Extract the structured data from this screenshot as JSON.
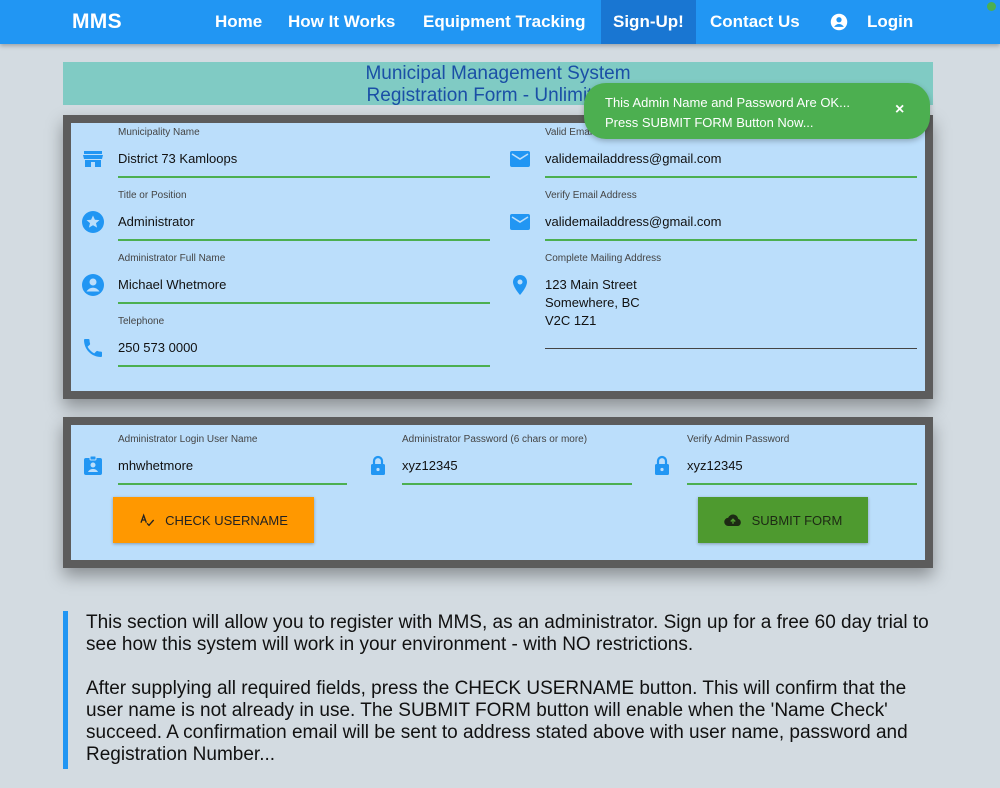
{
  "navbar": {
    "brand": "MMS",
    "items": [
      {
        "label": "Home"
      },
      {
        "label": "How It Works"
      },
      {
        "label": "Equipment Tracking"
      },
      {
        "label": "Sign-Up!"
      },
      {
        "label": "Contact Us"
      }
    ],
    "login_label": "Login"
  },
  "banner": {
    "line1": "Municipal Management System",
    "line2": "Registration Form - Unlimited 6"
  },
  "form": {
    "municipality": {
      "label": "Municipality Name",
      "value": "District 73 Kamloops"
    },
    "title": {
      "label": "Title or Position",
      "value": "Administrator"
    },
    "admin_name": {
      "label": "Administrator Full Name",
      "value": "Michael Whetmore"
    },
    "telephone": {
      "label": "Telephone",
      "value": "250 573 0000"
    },
    "email": {
      "label": "Valid Emai",
      "value": "validemailaddress@gmail.com"
    },
    "verify_email": {
      "label": "Verify Email Address",
      "value": "validemailaddress@gmail.com"
    },
    "address": {
      "label": "Complete Mailing Address",
      "lines": [
        "123 Main Street",
        "Somewhere, BC",
        "V2C 1Z1"
      ]
    }
  },
  "login_form": {
    "username": {
      "label": "Administrator Login User Name",
      "value": "mhwhetmore"
    },
    "password": {
      "label": "Administrator Password (6 chars or more)",
      "value": "xyz12345"
    },
    "verify_password": {
      "label": "Verify Admin Password",
      "value": "xyz12345"
    },
    "check_button": "CHECK USERNAME",
    "submit_button": "SUBMIT FORM"
  },
  "toast": {
    "line1": "This Admin Name and Password Are OK...",
    "line2": "Press SUBMIT FORM Button Now...",
    "close": "×"
  },
  "info": {
    "para1": "This section will allow you to register with MMS, as an administrator. Sign up for a free 60 day trial to see how this system will work in your environment - with NO restrictions.",
    "para2": "After supplying all required fields, press the CHECK USERNAME button. This will confirm that the user name is not already in use. The SUBMIT FORM button will enable when the 'Name Check' succeed. A confirmation email will be sent to address stated above with user name, password and Registration Number..."
  },
  "colors": {
    "primary": "#2196f3",
    "active_nav": "#1976d2",
    "field_bg": "#bbdefb",
    "underline": "#4caf50",
    "toast": "#4caf50",
    "check_button": "#ff9800",
    "submit_button": "#4e9a2f"
  },
  "icons": {
    "login": "account-circle-icon",
    "municipality": "store-icon",
    "title": "star-badge-icon",
    "admin_name": "account-circle-icon",
    "telephone": "phone-icon",
    "email": "email-icon",
    "verify_email": "email-icon",
    "address": "map-pin-icon",
    "username": "badge-icon",
    "password": "lock-icon",
    "verify_password": "lock-icon",
    "check": "spellcheck-icon",
    "submit": "cloud-upload-icon"
  }
}
